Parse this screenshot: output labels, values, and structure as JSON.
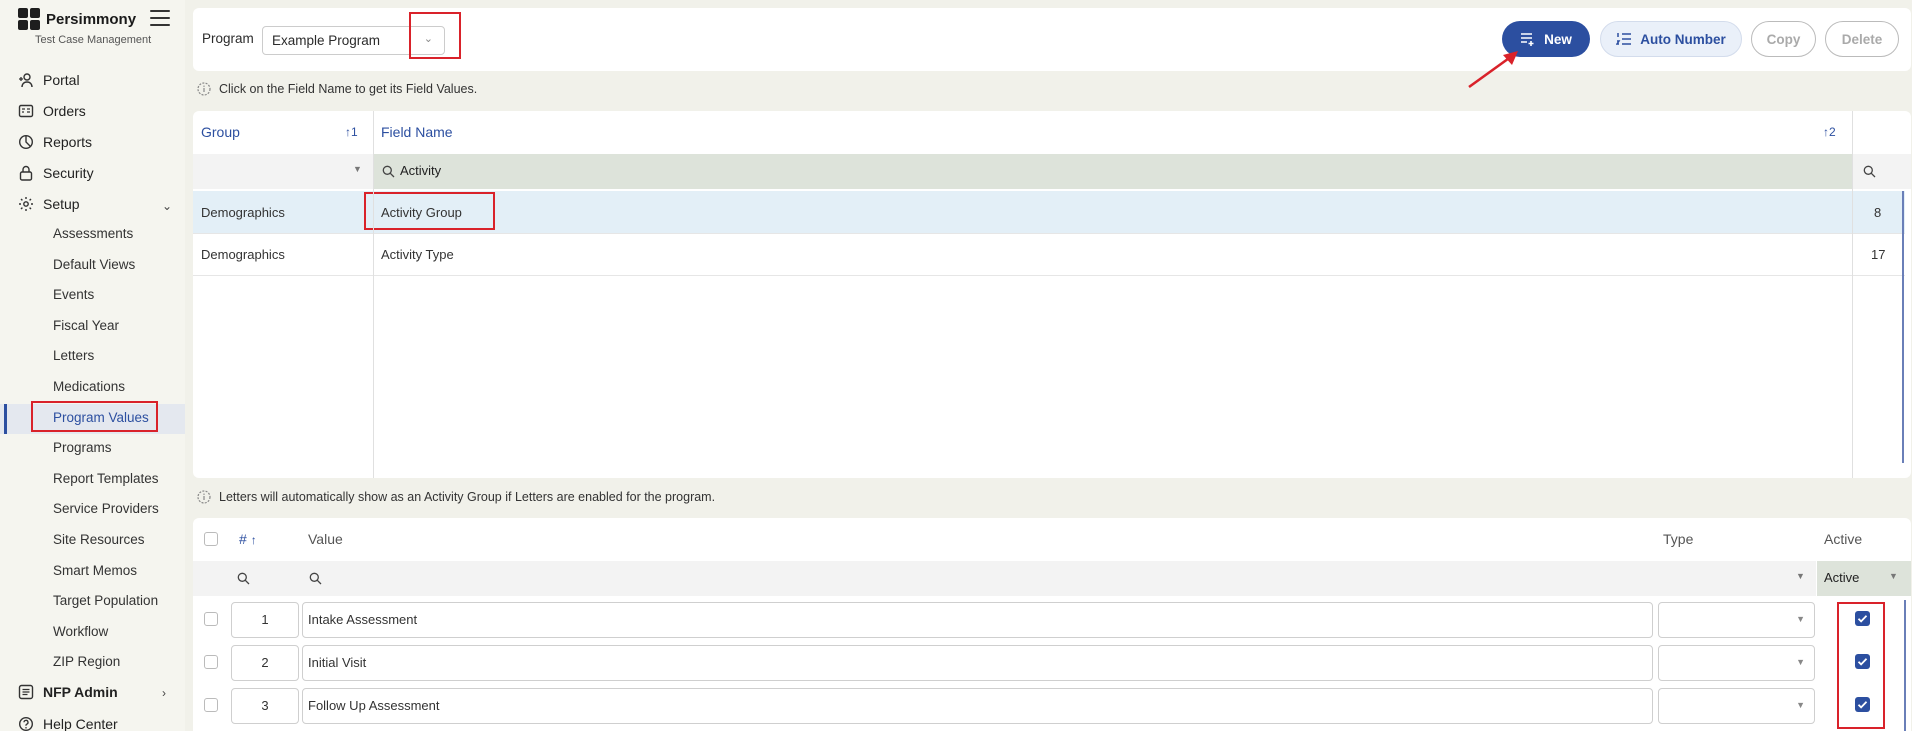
{
  "app": {
    "name": "Persimmony",
    "subtitle": "Test Case Management"
  },
  "sidebar": {
    "items": [
      {
        "label": "Portal",
        "icon": "portal-icon"
      },
      {
        "label": "Orders",
        "icon": "orders-icon"
      },
      {
        "label": "Reports",
        "icon": "reports-icon"
      },
      {
        "label": "Security",
        "icon": "lock-icon"
      },
      {
        "label": "Setup",
        "icon": "gear-icon"
      }
    ],
    "setup_items": [
      "Assessments",
      "Default Views",
      "Events",
      "Fiscal Year",
      "Letters",
      "Medications",
      "Program Values",
      "Programs",
      "Report Templates",
      "Service Providers",
      "Site Resources",
      "Smart Memos",
      "Target Population",
      "Workflow",
      "ZIP Region"
    ],
    "active_item": "Program Values",
    "nfp_admin": "NFP Admin",
    "help_center": "Help Center"
  },
  "toolbar": {
    "program_label": "Program",
    "program_value": "Example Program",
    "new_label": "New",
    "auto_number_label": "Auto Number",
    "copy_label": "Copy",
    "delete_label": "Delete"
  },
  "fields_info": "Click on the Field Name to get its Field Values.",
  "fields_table": {
    "group_header": "Group",
    "group_sort": "1",
    "field_header": "Field Name",
    "field_sort": "2",
    "filter_value": "Activity",
    "rows": [
      {
        "group": "Demographics",
        "field": "Activity Group",
        "count": "8"
      },
      {
        "group": "Demographics",
        "field": "Activity Type",
        "count": "17"
      }
    ]
  },
  "values_info": "Letters will automatically show as an Activity Group if Letters are enabled for the program.",
  "values_table": {
    "num_header": "#",
    "value_header": "Value",
    "type_header": "Type",
    "active_header": "Active",
    "active_filter": "Active",
    "rows": [
      {
        "num": "1",
        "value": "Intake Assessment",
        "active": true
      },
      {
        "num": "2",
        "value": "Initial Visit",
        "active": true
      },
      {
        "num": "3",
        "value": "Follow Up Assessment",
        "active": true
      }
    ]
  },
  "colors": {
    "accent": "#2c4fa0",
    "annotation": "#d9222a",
    "filter_bg": "#dde3da",
    "selected_row": "#e3eff7"
  }
}
